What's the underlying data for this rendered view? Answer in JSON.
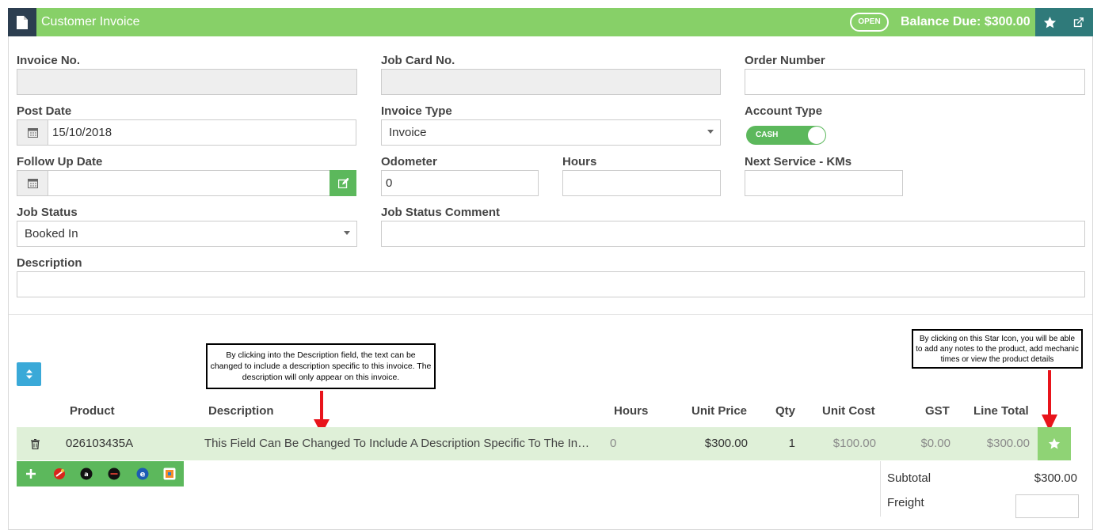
{
  "header": {
    "title": "Customer Invoice",
    "status_badge": "OPEN",
    "balance_due": "Balance Due: $300.00",
    "color": "#87d068"
  },
  "form": {
    "invoice_no": {
      "label": "Invoice No.",
      "value": ""
    },
    "job_card_no": {
      "label": "Job Card No.",
      "value": ""
    },
    "order_number": {
      "label": "Order Number",
      "value": ""
    },
    "post_date": {
      "label": "Post Date",
      "value": "15/10/2018"
    },
    "invoice_type": {
      "label": "Invoice Type",
      "value": "Invoice"
    },
    "account_type": {
      "label": "Account Type",
      "toggle_label": "CASH"
    },
    "follow_up_date": {
      "label": "Follow Up Date",
      "value": ""
    },
    "odometer": {
      "label": "Odometer",
      "value": "0"
    },
    "hours": {
      "label": "Hours",
      "value": ""
    },
    "next_service": {
      "label": "Next Service - KMs",
      "value": ""
    },
    "job_status": {
      "label": "Job Status",
      "value": "Booked In"
    },
    "job_status_comment": {
      "label": "Job Status Comment",
      "value": ""
    },
    "description": {
      "label": "Description",
      "value": ""
    }
  },
  "callouts": {
    "description_note": "By clicking into the Description field, the text can be changed to include a description specific to this invoice. The description will only appear on this invoice.",
    "star_note": "By clicking on this Star Icon, you will be able to add any notes to the product, add mechanic times or view the product details"
  },
  "table": {
    "columns": [
      "Product",
      "Description",
      "Hours",
      "Unit Price",
      "Qty",
      "Unit Cost",
      "GST",
      "Line Total"
    ],
    "rows": [
      {
        "product": "026103435A",
        "description": "This Field Can Be Changed To Include A Description Specific To The In…",
        "hours": "0",
        "unit_price": "$300.00",
        "qty": "1",
        "unit_cost": "$100.00",
        "gst": "$0.00",
        "line_total": "$300.00"
      }
    ]
  },
  "totals": {
    "subtotal_label": "Subtotal",
    "subtotal_value": "$300.00",
    "freight_label": "Freight"
  },
  "icons": {
    "header": [
      "document-icon",
      "star-icon",
      "external-link-icon"
    ],
    "action_bar": [
      "plus-icon",
      "integration-1-icon",
      "integration-2-icon",
      "integration-3-icon",
      "integration-4-icon",
      "integration-5-icon"
    ]
  }
}
